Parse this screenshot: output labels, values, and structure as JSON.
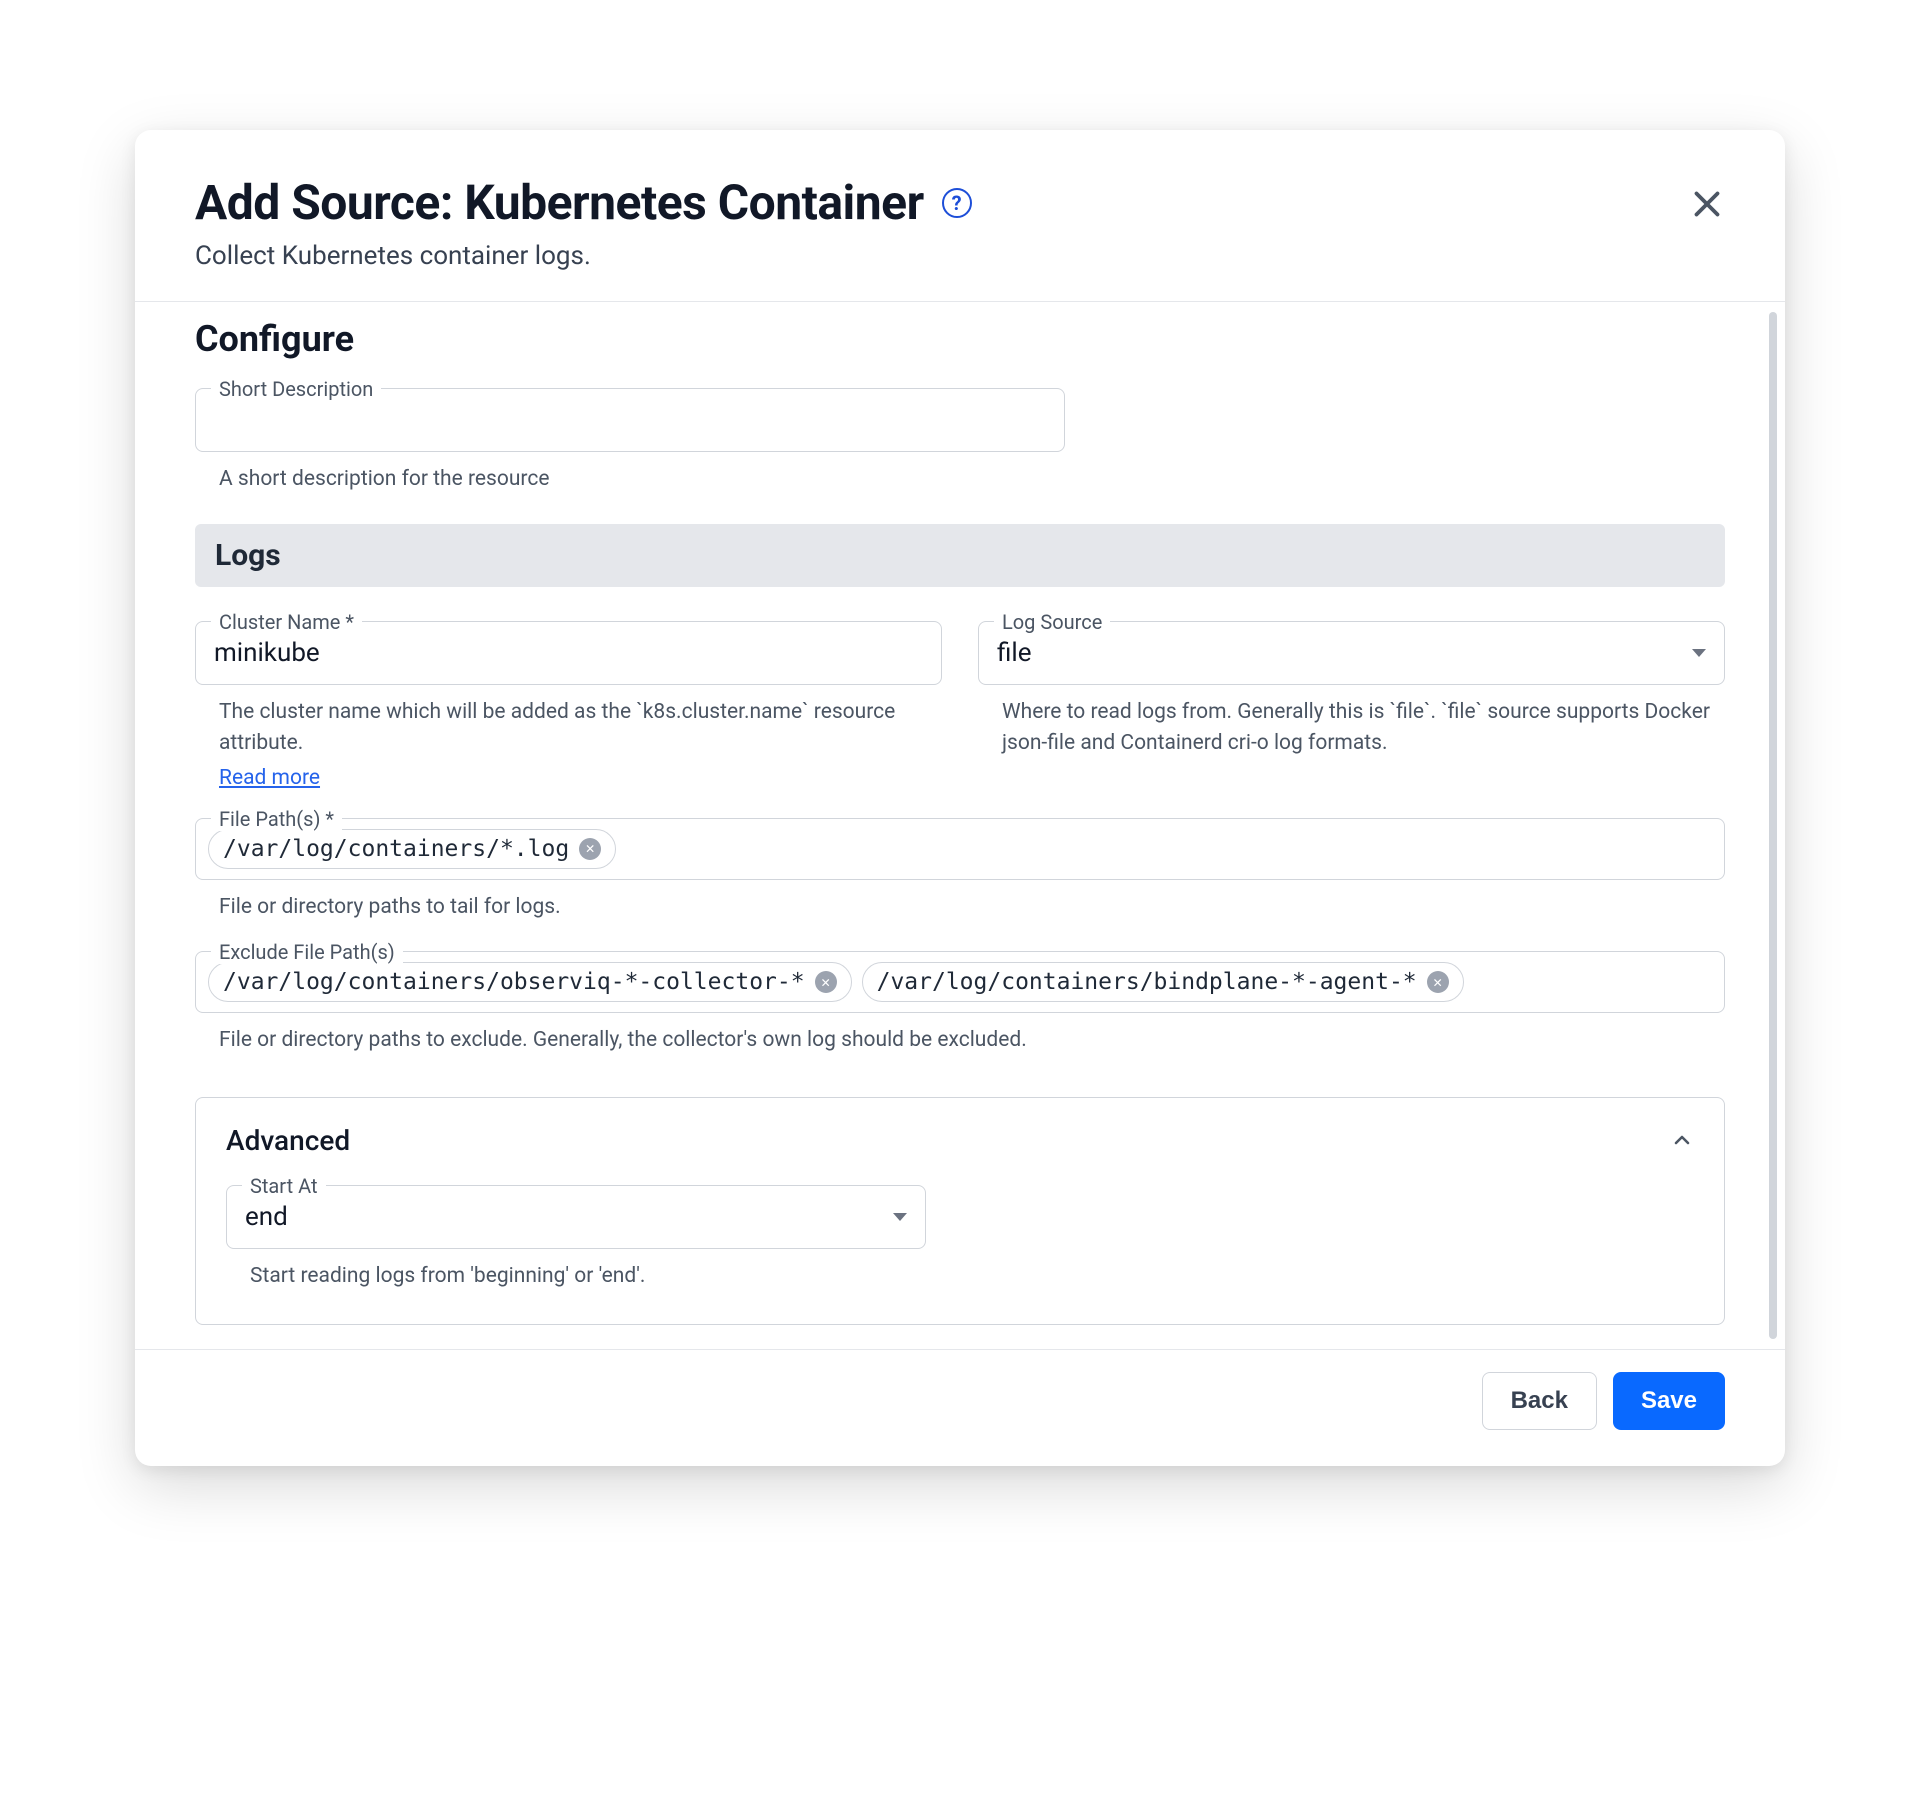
{
  "header": {
    "title": "Add Source: Kubernetes Container",
    "subtitle": "Collect Kubernetes container logs."
  },
  "configure": {
    "title": "Configure",
    "short_description": {
      "label": "Short Description",
      "value": "",
      "helper": "A short description for the resource"
    }
  },
  "logs": {
    "title": "Logs",
    "cluster_name": {
      "label": "Cluster Name *",
      "value": "minikube",
      "helper": "The cluster name which will be added as the `k8s.cluster.name` resource attribute.",
      "read_more": "Read more"
    },
    "log_source": {
      "label": "Log Source",
      "value": "file",
      "helper": "Where to read logs from. Generally this is `file`. `file` source supports Docker json-file and Containerd cri-o log formats."
    },
    "file_paths": {
      "label": "File Path(s) *",
      "chips": [
        "/var/log/containers/*.log"
      ],
      "helper": "File or directory paths to tail for logs."
    },
    "exclude_paths": {
      "label": "Exclude File Path(s)",
      "chips": [
        "/var/log/containers/observiq-*-collector-*",
        "/var/log/containers/bindplane-*-agent-*"
      ],
      "helper": "File or directory paths to exclude. Generally, the collector's own log should be excluded."
    }
  },
  "advanced": {
    "title": "Advanced",
    "start_at": {
      "label": "Start At",
      "value": "end",
      "helper": "Start reading logs from 'beginning' or 'end'."
    }
  },
  "footer": {
    "back": "Back",
    "save": "Save"
  }
}
